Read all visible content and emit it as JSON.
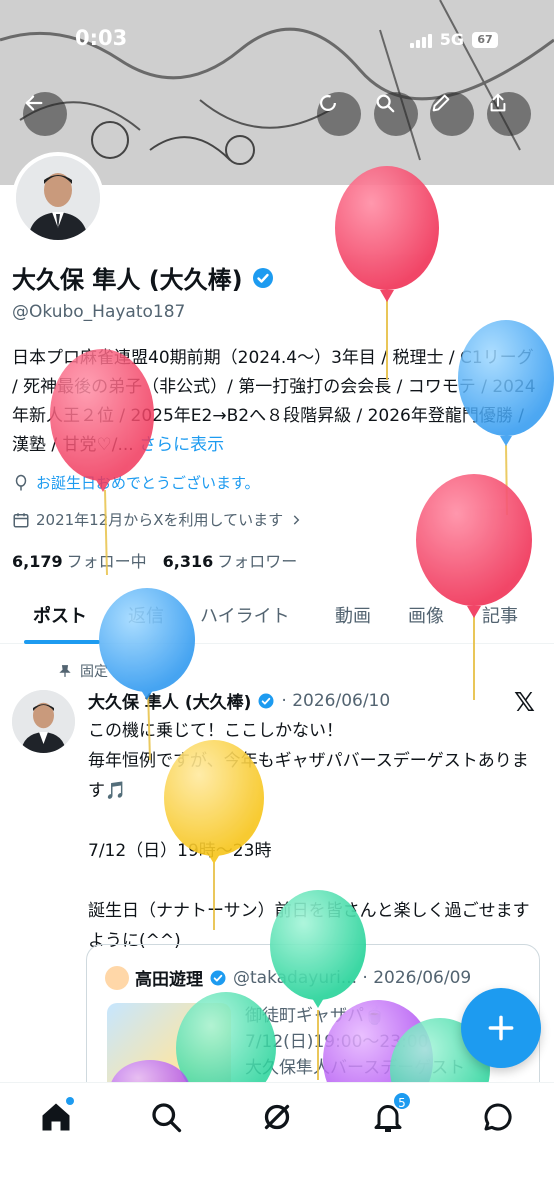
{
  "status_bar": {
    "time": "0:03",
    "network": "5G",
    "battery": "67"
  },
  "profile": {
    "display_name": "大久保 隼人 (大久棒)",
    "handle": "@Okubo_Hayato187",
    "bio": "日本プロ麻雀連盟40期前期（2024.4～）3年目 / 税理士 / C1リーグ / 死神最後の弟子（非公式）/ 第一打強打の会会長 / コワモテ / 2024年新人王２位 / 2025年E2→B2へ８段階昇級 / 2026年登龍門優勝 / 漢塾 / 甘党♡/...",
    "bio_more": "さらに表示",
    "birthday": "お誕生日おめでとうございます。",
    "joined": "2021年12月からXを利用しています",
    "following_count": "6,179",
    "following_label": "フォロー中",
    "followers_count": "6,316",
    "followers_label": "フォロワー"
  },
  "tabs": [
    "ポスト",
    "返信",
    "ハイライト",
    "動画",
    "画像",
    "記事"
  ],
  "post": {
    "pinned_label": "固定",
    "author": "大久保 隼人 (大久棒)",
    "date": "· 2026/06/10",
    "body": "この機に乗じて！ここしかない！\n毎年恒例ですが、今年もギャザパバースデーゲストあります🎵\n\n7/12（日）19時〜23時\n\n誕生日（ナナトーサン）前日を皆さんと楽しく過ごせますように(^^)",
    "quote": {
      "author": "高田遊理",
      "meta": "@takadayuri... · 2026/06/09",
      "text": "御徒町ギャザパ🍵\n7/12(日)19:00〜23:00\n大久保隼人バースデーゲスト"
    }
  },
  "bottom_nav": {
    "notifications_badge": "5"
  },
  "colors": {
    "accent": "#1d9bf0",
    "text": "#0f1419",
    "muted": "#536471"
  },
  "icons": [
    "back-icon",
    "refresh-icon",
    "search-icon",
    "edit-icon",
    "share-icon",
    "verified-icon",
    "balloon-icon",
    "calendar-icon",
    "pin-icon",
    "x-logo-icon",
    "plus-icon",
    "home-icon",
    "grok-icon",
    "bell-icon",
    "messages-icon"
  ]
}
